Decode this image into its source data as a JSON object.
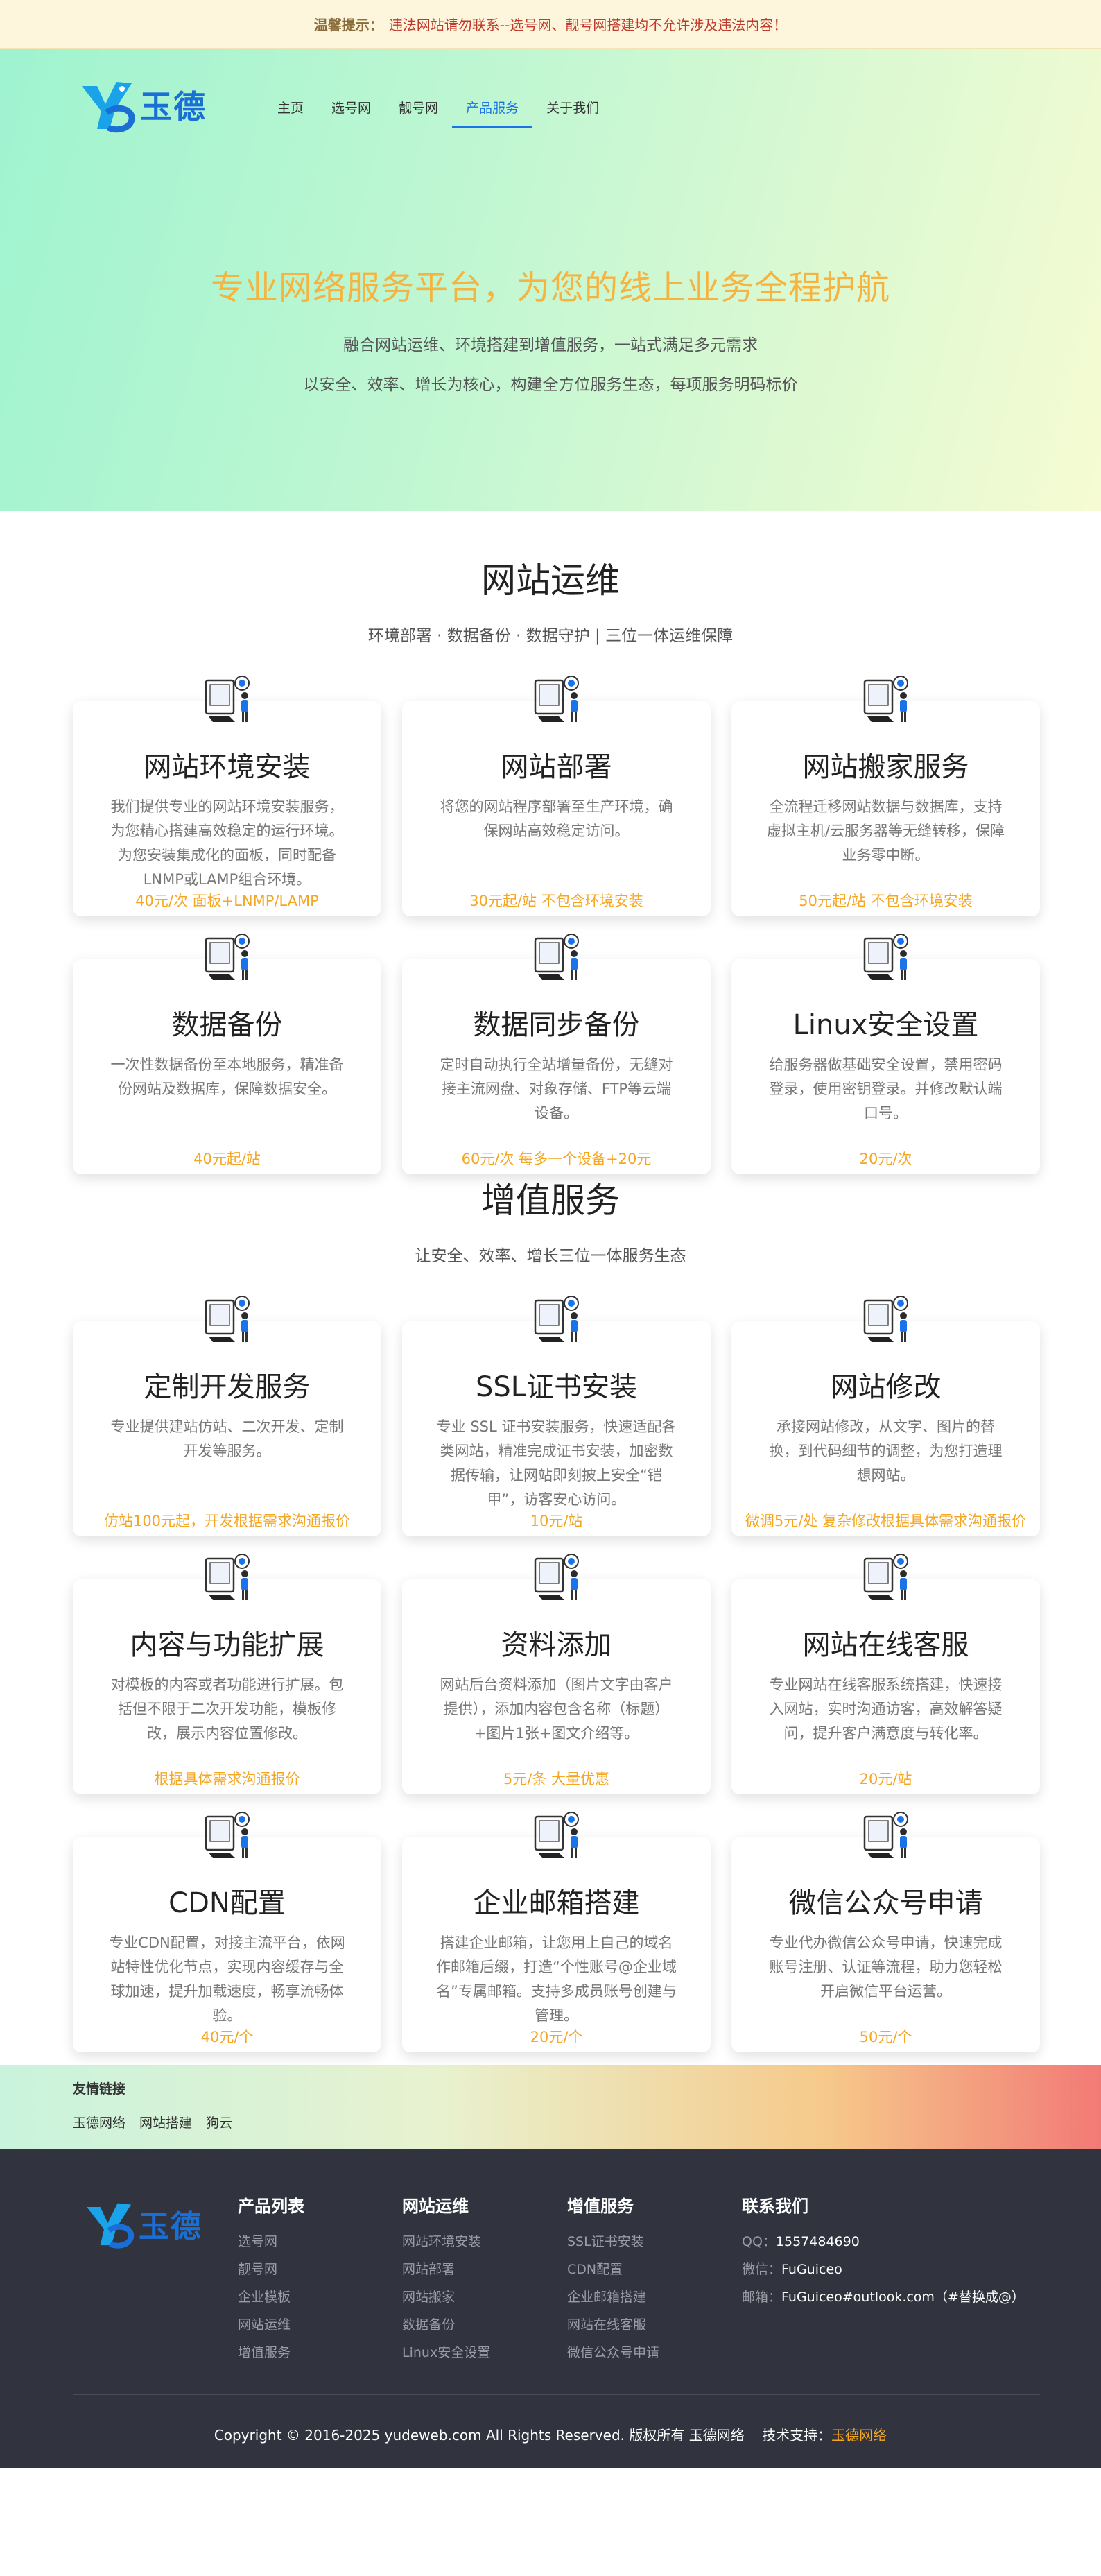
{
  "notice": {
    "label": "温馨提示：",
    "text": "违法网站请勿联系--选号网、靓号网搭建均不允许涉及违法内容！"
  },
  "header": {
    "logo_text": "玉德",
    "menu": [
      {
        "label": "主页",
        "active": false
      },
      {
        "label": "选号网",
        "active": false
      },
      {
        "label": "靓号网",
        "active": false
      },
      {
        "label": "产品服务",
        "active": true
      },
      {
        "label": "关于我们",
        "active": false
      }
    ]
  },
  "hero": {
    "title": "专业网络服务平台，为您的线上业务全程护航",
    "sub1": "融合网站运维、环境搭建到增值服务，一站式满足多元需求",
    "sub2": "以安全、效率、增长为核心，构建全方位服务生态，每项服务明码标价"
  },
  "ops": {
    "title": "网站运维",
    "subtitle": "环境部署 · 数据备份 · 数据守护 | 三位一体运维保障",
    "cards": [
      {
        "title": "网站环境安装",
        "desc": "我们提供专业的网站环境安装服务，为您精心搭建高效稳定的运行环境。为您安装集成化的面板，同时配备LNMP或LAMP组合环境。",
        "price": "40元/次 面板+LNMP/LAMP"
      },
      {
        "title": "网站部署",
        "desc": "将您的网站程序部署至生产环境，确保网站高效稳定访问。",
        "price": "30元起/站 不包含环境安装"
      },
      {
        "title": "网站搬家服务",
        "desc": "全流程迁移网站数据与数据库，支持虚拟主机/云服务器等无缝转移，保障业务零中断。",
        "price": "50元起/站 不包含环境安装"
      },
      {
        "title": "数据备份",
        "desc": "一次性数据备份至本地服务，精准备份网站及数据库，保障数据安全。",
        "price": "40元起/站"
      },
      {
        "title": "数据同步备份",
        "desc": "定时自动执行全站增量备份，无缝对接主流网盘、对象存储、FTP等云端设备。",
        "price": "60元/次 每多一个设备+20元"
      },
      {
        "title": "Linux安全设置",
        "desc": "给服务器做基础安全设置，禁用密码登录，使用密钥登录。并修改默认端口号。",
        "price": "20元/次"
      }
    ]
  },
  "vas": {
    "title": "增值服务",
    "subtitle": "让安全、效率、增长三位一体服务生态",
    "cards": [
      {
        "title": "定制开发服务",
        "desc": "专业提供建站仿站、二次开发、定制开发等服务。",
        "price": "仿站100元起，开发根据需求沟通报价"
      },
      {
        "title": "SSL证书安装",
        "desc": "专业 SSL 证书安装服务，快速适配各类网站，精准完成证书安装，加密数据传输，让网站即刻披上安全“铠甲”，访客安心访问。",
        "price": "10元/站"
      },
      {
        "title": "网站修改",
        "desc": "承接网站修改，从文字、图片的替换，到代码细节的调整，为您打造理想网站。",
        "price": "微调5元/处 复杂修改根据具体需求沟通报价"
      },
      {
        "title": "内容与功能扩展",
        "desc": "对模板的内容或者功能进行扩展。包括但不限于二次开发功能，模板修改，展示内容位置修改。",
        "price": "根据具体需求沟通报价"
      },
      {
        "title": "资料添加",
        "desc": "网站后台资料添加（图片文字由客户提供），添加内容包含名称（标题）+图片1张+图文介绍等。",
        "price": "5元/条 大量优惠"
      },
      {
        "title": "网站在线客服",
        "desc": "专业网站在线客服系统搭建，快速接入网站，实时沟通访客，高效解答疑问，提升客户满意度与转化率。",
        "price": "20元/站"
      },
      {
        "title": "CDN配置",
        "desc": "专业CDN配置，对接主流平台，依网站特性优化节点，实现内容缓存与全球加速，提升加载速度，畅享流畅体验。",
        "price": "40元/个"
      },
      {
        "title": "企业邮箱搭建",
        "desc": "搭建企业邮箱，让您用上自己的域名作邮箱后缀，打造“个性账号@企业域名”专属邮箱。支持多成员账号创建与管理。",
        "price": "20元/个"
      },
      {
        "title": "微信公众号申请",
        "desc": "专业代办微信公众号申请，快速完成账号注册、认证等流程，助力您轻松开启微信平台运营。",
        "price": "50元/个"
      }
    ]
  },
  "friends": {
    "title": "友情链接",
    "links": [
      "玉德网络",
      "网站搭建",
      "狗云"
    ]
  },
  "footer": {
    "logo_text": "玉德",
    "col1": {
      "title": "产品列表",
      "items": [
        "选号网",
        "靓号网",
        "企业模板",
        "网站运维",
        "增值服务"
      ]
    },
    "col2": {
      "title": "网站运维",
      "items": [
        "网站环境安装",
        "网站部署",
        "网站搬家",
        "数据备份",
        "Linux安全设置"
      ]
    },
    "col3": {
      "title": "增值服务",
      "items": [
        "SSL证书安装",
        "CDN配置",
        "企业邮箱搭建",
        "网站在线客服",
        "微信公众号申请"
      ]
    },
    "col4": {
      "title": "联系我们",
      "qq_label": "QQ：",
      "qq": "1557484690",
      "wx_label": "微信：",
      "wx": "FuGuiceo",
      "mail_label": "邮箱：",
      "mail": "FuGuiceo#outlook.com（#替换成@）"
    },
    "copyright": "Copyright © 2016-2025 yudeweb.com All Rights Reserved. 版权所有 玉德网络",
    "support_label": "技术支持：",
    "support": "玉德网络"
  },
  "colors": {
    "accent": "#1a73e8",
    "price": "#f5a623",
    "hero_title": "#f6b340",
    "footer_bg": "#31343f"
  }
}
